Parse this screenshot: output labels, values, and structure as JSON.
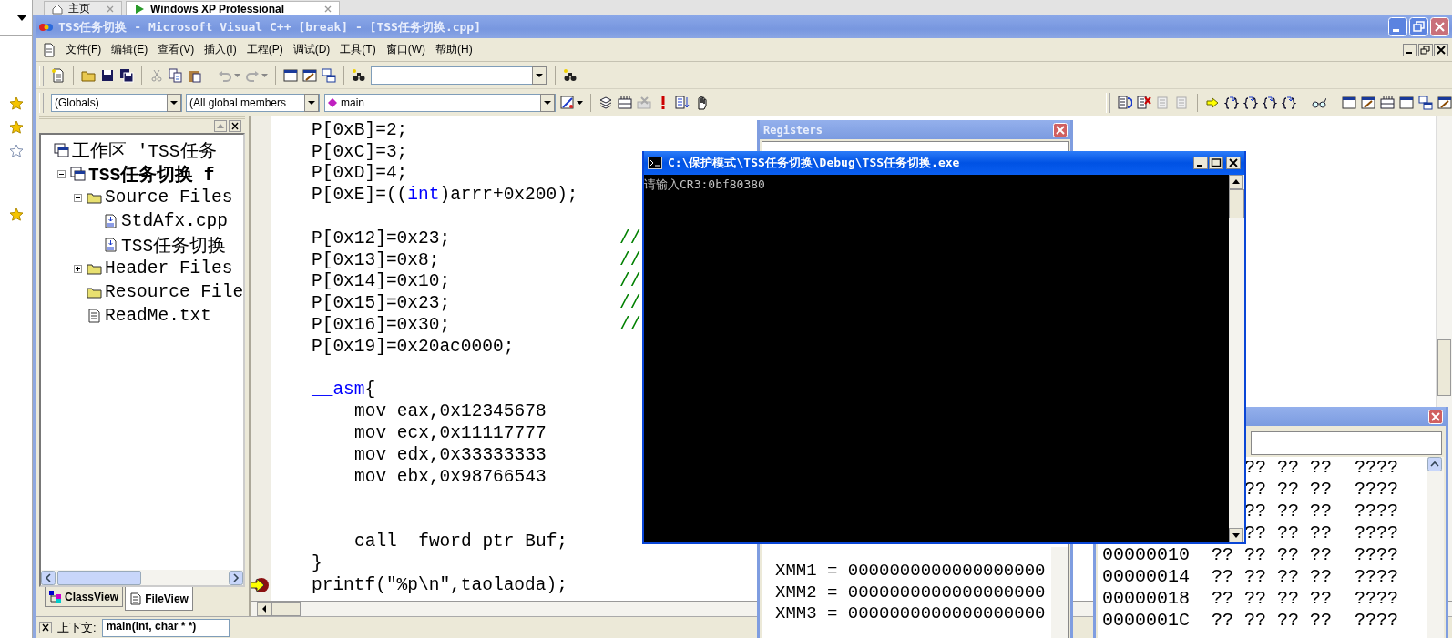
{
  "browser_sidebar": {
    "favorites": [
      {
        "starred": true
      },
      {
        "starred": true
      },
      {
        "starred": false
      },
      {
        "starred": true
      }
    ]
  },
  "browser_tabs": [
    {
      "label": "主页",
      "selected": false
    },
    {
      "label": "Windows XP Professional",
      "selected": true
    }
  ],
  "window": {
    "title": "TSS任务切换 - Microsoft Visual C++ [break] - [TSS任务切换.cpp]"
  },
  "menu": [
    "文件(F)",
    "编辑(E)",
    "查看(V)",
    "插入(I)",
    "工程(P)",
    "调试(D)",
    "工具(T)",
    "窗口(W)",
    "帮助(H)"
  ],
  "wizard_bar": {
    "class": "(Globals)",
    "filter": "(All global members",
    "member": "main"
  },
  "workspace": {
    "tree": [
      {
        "label": "工作区 'TSS任务",
        "kind": "workspace",
        "children": [
          {
            "label": "TSS任务切换 f",
            "kind": "project",
            "expanded": true,
            "children": [
              {
                "label": "Source Files",
                "kind": "folder",
                "expanded": true,
                "children": [
                  {
                    "label": "StdAfx.cpp",
                    "kind": "source"
                  },
                  {
                    "label": "TSS任务切换",
                    "kind": "source"
                  }
                ]
              },
              {
                "label": "Header Files",
                "kind": "folder",
                "expanded": false
              },
              {
                "label": "Resource File",
                "kind": "folder"
              },
              {
                "label": "ReadMe.txt",
                "kind": "text"
              }
            ]
          }
        ]
      }
    ],
    "tabs": [
      {
        "label": "ClassView",
        "selected": false
      },
      {
        "label": "FileView",
        "selected": true
      }
    ]
  },
  "editor": {
    "lines": [
      {
        "kind": "code",
        "segments": [
          {
            "text": "P[0xB]=2;"
          }
        ]
      },
      {
        "kind": "code",
        "segments": [
          {
            "text": "P[0xC]=3;"
          }
        ]
      },
      {
        "kind": "code",
        "segments": [
          {
            "text": "P[0xD]=4;"
          }
        ]
      },
      {
        "kind": "code",
        "segments": [
          {
            "text": "P[0xE]=(("
          },
          {
            "text": "int",
            "kind": "keyword"
          },
          {
            "text": ")arrr+0x200);"
          }
        ]
      },
      {
        "kind": "blank"
      },
      {
        "kind": "code",
        "segments": [
          {
            "text": "P[0x12]=0x23;"
          }
        ],
        "comment": "//"
      },
      {
        "kind": "code",
        "segments": [
          {
            "text": "P[0x13]=0x8;"
          }
        ],
        "comment": "//"
      },
      {
        "kind": "code",
        "segments": [
          {
            "text": "P[0x14]=0x10;"
          }
        ],
        "comment": "//"
      },
      {
        "kind": "code",
        "segments": [
          {
            "text": "P[0x15]=0x23;"
          }
        ],
        "comment": "//"
      },
      {
        "kind": "code",
        "segments": [
          {
            "text": "P[0x16]=0x30;"
          }
        ],
        "comment": "//"
      },
      {
        "kind": "code",
        "segments": [
          {
            "text": "P[0x19]=0x20ac0000;"
          }
        ]
      },
      {
        "kind": "blank"
      },
      {
        "kind": "code",
        "segments": [
          {
            "text": "__asm",
            "kind": "keyword"
          },
          {
            "text": "{"
          }
        ]
      },
      {
        "kind": "code",
        "indented": true,
        "segments": [
          {
            "text": "mov eax,0x12345678"
          }
        ]
      },
      {
        "kind": "code",
        "indented": true,
        "segments": [
          {
            "text": "mov ecx,0x11117777"
          }
        ]
      },
      {
        "kind": "code",
        "indented": true,
        "segments": [
          {
            "text": "mov edx,0x33333333"
          }
        ]
      },
      {
        "kind": "code",
        "indented": true,
        "segments": [
          {
            "text": "mov ebx,0x98766543"
          }
        ]
      },
      {
        "kind": "blank"
      },
      {
        "kind": "blank"
      },
      {
        "kind": "code",
        "indented": true,
        "segments": [
          {
            "text": "call  fword ptr Buf;"
          }
        ]
      },
      {
        "kind": "code",
        "segments": [
          {
            "text": "}"
          }
        ]
      },
      {
        "kind": "code",
        "current": true,
        "segments": [
          {
            "text": "printf(\"%p\\n\",taolaoda);"
          }
        ]
      }
    ]
  },
  "registers": {
    "title": "Registers",
    "rows": [
      {
        "text": "XMM1 = 0000000000000000000"
      },
      {
        "text": "XMM2 = 0000000000000000000"
      },
      {
        "text": "XMM3 = 0000000000000000000"
      }
    ]
  },
  "memory": {
    "rows": [
      {
        "bytes": [
          "??",
          "??",
          "??"
        ],
        "chars": "????"
      },
      {
        "bytes": [
          "??",
          "??",
          "??"
        ],
        "chars": "????"
      },
      {
        "bytes": [
          "??",
          "??",
          "??"
        ],
        "chars": "????"
      },
      {
        "bytes": [
          "??",
          "??",
          "??"
        ],
        "chars": "????"
      },
      {
        "address": "00000010",
        "bytes": [
          "??",
          "??",
          "??",
          "??"
        ],
        "chars": "????"
      },
      {
        "address": "00000014",
        "bytes": [
          "??",
          "??",
          "??",
          "??"
        ],
        "chars": "????"
      },
      {
        "address": "00000018",
        "bytes": [
          "??",
          "??",
          "??",
          "??"
        ],
        "chars": "????"
      },
      {
        "address": "0000001C",
        "bytes": [
          "??",
          "??",
          "??",
          "??"
        ],
        "chars": "????"
      }
    ]
  },
  "console": {
    "title": "C:\\保护模式\\TSS任务切换\\Debug\\TSS任务切换.exe",
    "output": "请输入CR3:0bf80380"
  },
  "context_bar": {
    "label": "上下文:",
    "value": "main(int, char * *)"
  }
}
